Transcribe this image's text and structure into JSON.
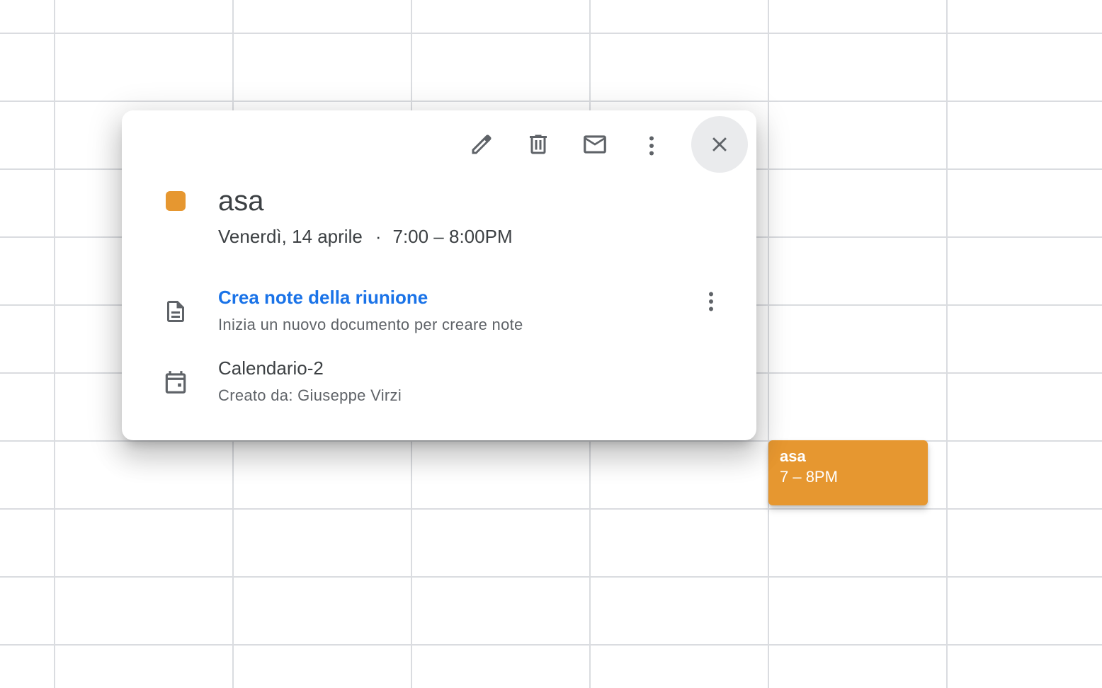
{
  "event": {
    "title": "asa",
    "date": "Venerdì, 14 aprile",
    "separator": "·",
    "time": "7:00 – 8:00PM",
    "color": "#e69730"
  },
  "toolbar": {
    "edit_icon": "pencil-icon",
    "delete_icon": "trash-icon",
    "email_icon": "mail-icon",
    "more_icon": "more-vert-icon",
    "close_icon": "close-icon"
  },
  "notes": {
    "link": "Crea note della riunione",
    "subtitle": "Inizia un nuovo documento per creare note",
    "icon": "document-icon",
    "more_icon": "more-vert-icon"
  },
  "calendar": {
    "name": "Calendario-2",
    "creator": "Creato da: Giuseppe Virzi",
    "icon": "calendar-icon"
  },
  "chip": {
    "title": "asa",
    "time": "7 – 8PM"
  }
}
